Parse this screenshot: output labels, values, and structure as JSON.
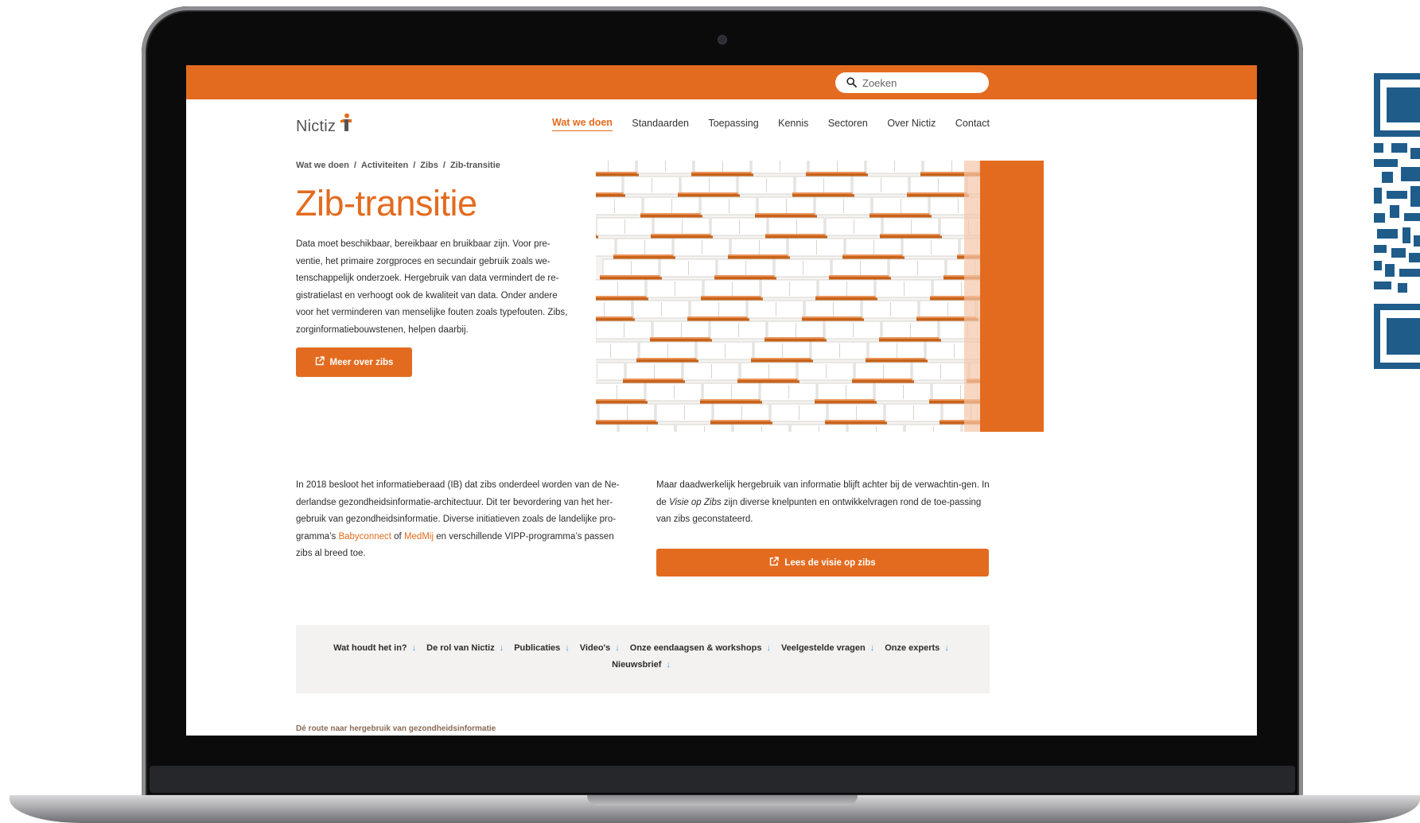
{
  "search": {
    "placeholder": "Zoeken"
  },
  "logo": {
    "text": "Nictiz"
  },
  "nav": {
    "items": [
      {
        "label": "Wat we doen",
        "active": true
      },
      {
        "label": "Standaarden"
      },
      {
        "label": "Toepassing"
      },
      {
        "label": "Kennis"
      },
      {
        "label": "Sectoren"
      },
      {
        "label": "Over Nictiz"
      },
      {
        "label": "Contact"
      }
    ]
  },
  "breadcrumb": [
    "Wat we doen",
    "Activiteiten",
    "Zibs",
    "Zib-transitie"
  ],
  "page": {
    "title": "Zib-transitie",
    "intro": "Data moet beschikbaar, bereikbaar en bruikbaar zijn. Voor pre-ventie, het primaire zorgproces en secundair gebruik zoals we-tenschappelijk onderzoek. Hergebruik van data vermindert de re-gistratielast en verhoogt ook de kwaliteit van data. Onder andere voor het verminderen van menselijke fouten zoals typefouten. Zibs, zorginformatiebouwstenen, helpen daarbij.",
    "intro_button": "Meer over zibs"
  },
  "content": {
    "left_part1": "In 2018 besloot het informatieberaad (IB) dat zibs onderdeel worden van de Ne-derlandse gezondheidsinformatie-architectuur. Dit ter bevordering van het her-gebruik van gezondheidsinformatie. Diverse initiatieven zoals de landelijke pro-gramma’s ",
    "left_link1": "Babyconnect",
    "left_part2": " of ",
    "left_link2": "MedMij",
    "left_part3": " en verschillende VIPP-programma’s passen zibs al breed toe.",
    "right_part1": "Maar daadwerkelijk hergebruik van informatie blijft achter bij de verwachtin-gen. In de ",
    "right_italic": "Visie op Zibs",
    "right_part2": " zijn diverse knelpunten en ontwikkelvragen rond de toe-passing van zibs geconstateerd.",
    "right_button": "Lees de visie op zibs"
  },
  "anchors": [
    "Wat houdt het in?",
    "De rol van Nictiz",
    "Publicaties",
    "Video's",
    "Onze eendaagsen & workshops",
    "Veelgestelde vragen",
    "Onze experts",
    "Nieuwsbrief"
  ],
  "footer_tag": "Dé route naar hergebruik van gezondheidsinformatie",
  "colors": {
    "accent": "#e36b1f",
    "anchor_arrow": "#4a9fd8",
    "anchor_bg": "#f3f2f0"
  },
  "icons": [
    "search-icon",
    "external-link-icon",
    "arrow-down-icon",
    "qr-code",
    "logo-figure-icon"
  ]
}
